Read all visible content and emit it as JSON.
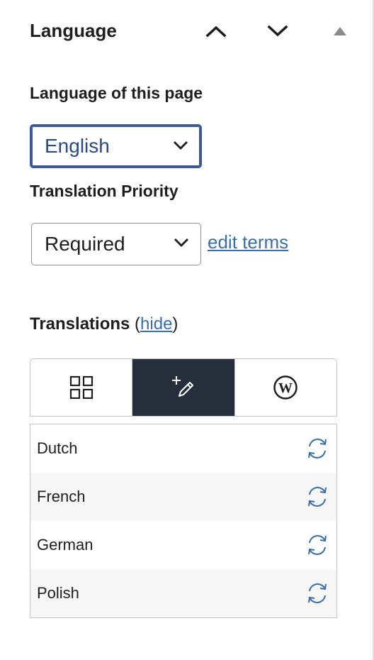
{
  "header": {
    "title": "Language",
    "move_up_icon": "chevron-up-icon",
    "move_down_icon": "chevron-down-icon",
    "toggle_icon": "triangle-up-icon"
  },
  "language_of_page": {
    "label": "Language of this page",
    "selected": "English"
  },
  "translation_priority": {
    "label": "Translation Priority",
    "selected": "Required",
    "edit_link": "edit terms"
  },
  "translations": {
    "label": "Translations",
    "open_paren": " (",
    "hide_link": "hide",
    "close_paren": ")",
    "tabs": [
      {
        "icon": "grid-icon",
        "active": false
      },
      {
        "icon": "add-edit-icon",
        "active": true
      },
      {
        "icon": "wordpress-icon",
        "active": false
      }
    ],
    "languages": [
      {
        "name": "Dutch",
        "icon": "sync-icon"
      },
      {
        "name": "French",
        "icon": "sync-icon"
      },
      {
        "name": "German",
        "icon": "sync-icon"
      },
      {
        "name": "Polish",
        "icon": "sync-icon"
      }
    ]
  },
  "colors": {
    "accent_link": "#3a6ea5",
    "active_tab_bg": "#262e3c",
    "focus_border": "#3b5998"
  }
}
